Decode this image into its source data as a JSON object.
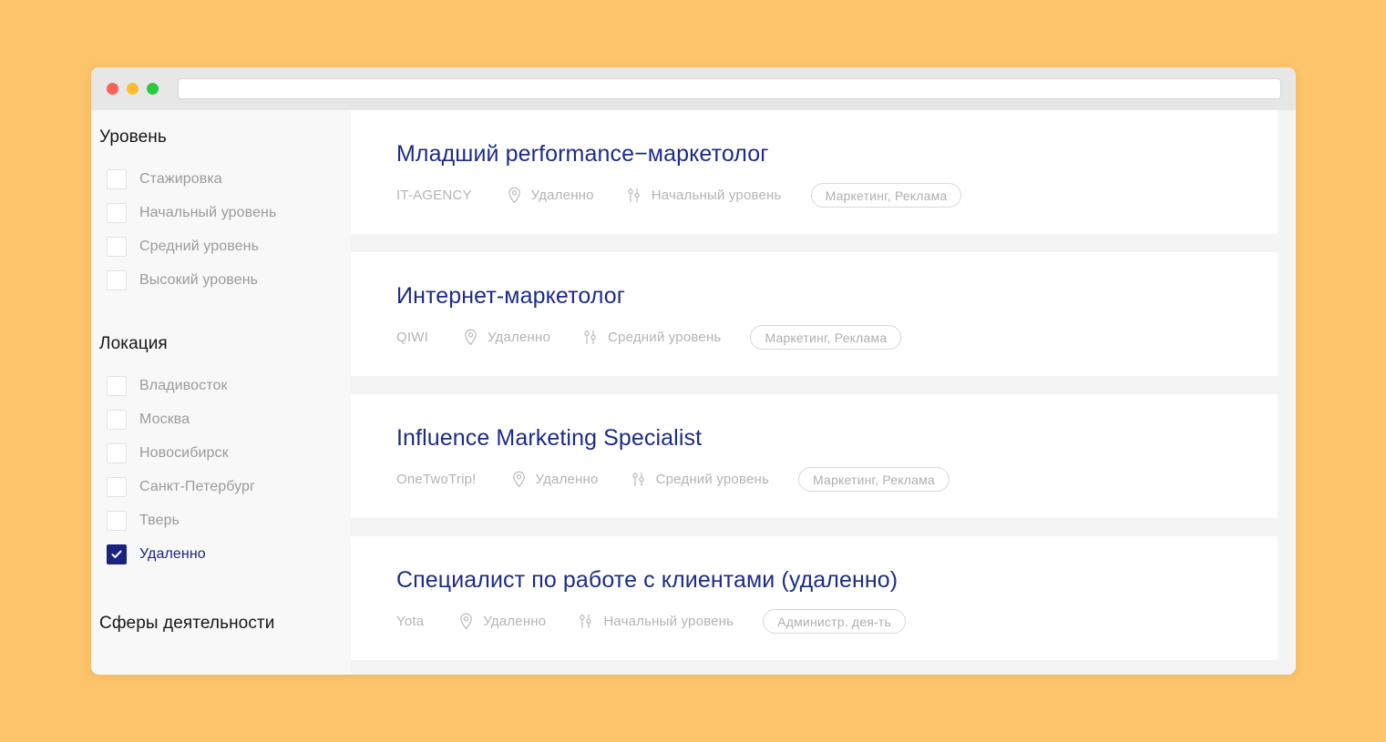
{
  "window": {
    "traffic_lights": [
      "close",
      "minimize",
      "maximize"
    ],
    "address_bar_value": "",
    "address_bar_placeholder": ""
  },
  "colors": {
    "page_background": "#FDC46C",
    "chrome": "#E7E7E7",
    "sidebar": "#F8F8F8",
    "card": "#FFFFFF",
    "gap": "#F4F4F4",
    "title_navy": "#1D2C86",
    "checked_navy": "#1A2480",
    "muted_text": "#B4B4B4",
    "label_text": "#9B9B9B",
    "heading_text": "#161616"
  },
  "sidebar": {
    "groups": [
      {
        "heading": "Уровень",
        "items": [
          {
            "label": "Стажировка",
            "checked": false
          },
          {
            "label": "Начальный уровень",
            "checked": false
          },
          {
            "label": "Средний уровень",
            "checked": false
          },
          {
            "label": "Высокий уровень",
            "checked": false
          }
        ]
      },
      {
        "heading": "Локация",
        "items": [
          {
            "label": "Владивосток",
            "checked": false
          },
          {
            "label": "Москва",
            "checked": false
          },
          {
            "label": "Новосибирск",
            "checked": false
          },
          {
            "label": "Санкт-Петербург",
            "checked": false
          },
          {
            "label": "Тверь",
            "checked": false
          },
          {
            "label": "Удаленно",
            "checked": true
          }
        ]
      },
      {
        "heading": "Сферы деятельности",
        "items": []
      }
    ]
  },
  "jobs": [
    {
      "title": "Младший performance−маркетолог",
      "company": "IT-AGENCY",
      "location": "Удаленно",
      "level": "Начальный уровень",
      "tag": "Маркетинг, Реклама"
    },
    {
      "title": "Интернет-маркетолог",
      "company": "QIWI",
      "location": "Удаленно",
      "level": "Средний уровень",
      "tag": "Маркетинг, Реклама"
    },
    {
      "title": "Influence Marketing Specialist",
      "company": "OneTwoTrip!",
      "location": "Удаленно",
      "level": "Средний уровень",
      "tag": "Маркетинг, Реклама"
    },
    {
      "title": "Специалист по работе с клиентами (удаленно)",
      "company": "Yota",
      "location": "Удаленно",
      "level": "Начальный уровень",
      "tag": "Администр. дея-ть"
    }
  ]
}
